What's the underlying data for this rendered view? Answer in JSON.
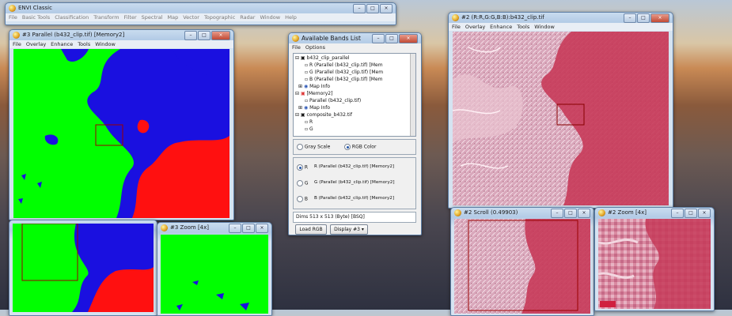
{
  "envi_main": {
    "title": "ENVI Classic",
    "menu": [
      "File",
      "Basic Tools",
      "Classification",
      "Transform",
      "Filter",
      "Spectral",
      "Map",
      "Vector",
      "Topographic",
      "Radar",
      "Window",
      "Help"
    ]
  },
  "window3": {
    "title": "#3 Parallel (b432_clip.tif) [Memory2]",
    "menu": [
      "File",
      "Overlay",
      "Enhance",
      "Tools",
      "Window"
    ]
  },
  "window3_zoom": {
    "title": "#3 Zoom [4x]"
  },
  "bands": {
    "title": "Available Bands List",
    "menu": [
      "File",
      "Options"
    ],
    "tree": [
      "b432_clip_parallel",
      "R (Parallel (b432_clip.tif) [Mem",
      "G (Parallel (b432_clip.tif) [Mem",
      "B (Parallel (b432_clip.tif) [Mem",
      "Map Info",
      "[Memory2]",
      "Parallel (b432_clip.tif)",
      "Map Info",
      "composite_b432.tif",
      "R",
      "G"
    ],
    "gray_label": "Gray Scale",
    "rgb_label": "RGB Color",
    "r_letter": "R",
    "g_letter": "G",
    "b_letter": "B",
    "r_band": "R (Parallel (b432_clip.tif) [Memory2]",
    "g_band": "G (Parallel (b432_clip.tif) [Memory2]",
    "b_band": "B (Parallel (b432_clip.tif) [Memory2]",
    "dims": "Dims 513 x 513 (Byte) [BSQ]",
    "load_btn": "Load RGB",
    "display_btn": "Display #3 ▾"
  },
  "window2": {
    "title": "#2 (R:R,G:G,B:B):b432_clip.tif",
    "menu": [
      "File",
      "Overlay",
      "Enhance",
      "Tools",
      "Window"
    ]
  },
  "window2_scroll": {
    "title": "#2 Scroll (0.49903)"
  },
  "window2_zoom": {
    "title": "#2 Zoom [4x]"
  },
  "colors": {
    "class_green": "#00ff00",
    "class_blue": "#1a10e0",
    "class_red": "#ff1010",
    "accent": "#3a7bd5"
  }
}
